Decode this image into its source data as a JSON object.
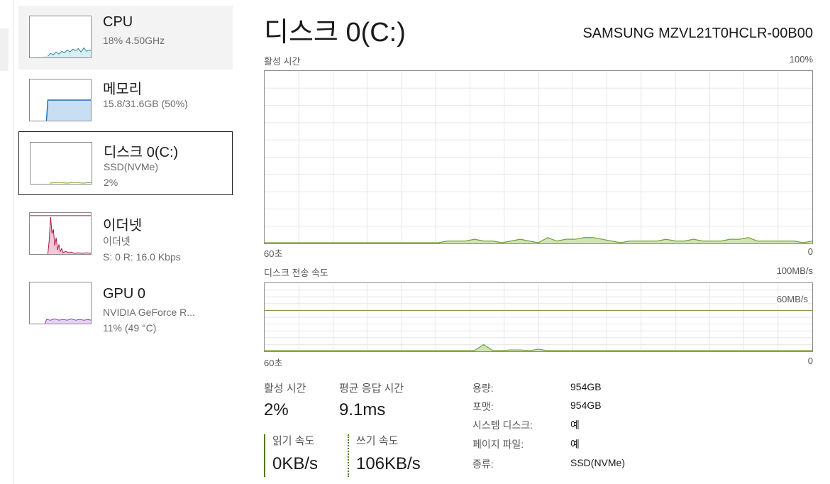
{
  "sidebar": {
    "items": [
      {
        "title": "CPU",
        "lines": [
          "18% 4.50GHz"
        ],
        "color": "#1a8aa8",
        "selected": false
      },
      {
        "title": "메모리",
        "lines": [
          "15.8/31.6GB (50%)"
        ],
        "color": "#1e6fc0",
        "selected": false
      },
      {
        "title": "디스크 0(C:)",
        "lines": [
          "SSD(NVMe)",
          "2%"
        ],
        "color": "#4c8a1e",
        "selected": true
      },
      {
        "title": "이더넷",
        "lines": [
          "이더넷",
          "S: 0 R: 16.0 Kbps"
        ],
        "color": "#b0124a",
        "selected": false
      },
      {
        "title": "GPU 0",
        "lines": [
          "NVIDIA GeForce R...",
          "11% (49 °C)"
        ],
        "color": "#8a2bbf",
        "selected": false
      }
    ]
  },
  "main": {
    "title": "디스크 0(C:)",
    "model": "SAMSUNG MZVL21T0HCLR-00B00",
    "active_chart": {
      "label": "활성 시간",
      "max_label": "100%",
      "x_left": "60초",
      "x_right": "0",
      "values": [
        0,
        0,
        0,
        0,
        0,
        0,
        0,
        0,
        0,
        0,
        0,
        0,
        0,
        0,
        0,
        0,
        0,
        0,
        0,
        0,
        1,
        1,
        1,
        2,
        1,
        1,
        0,
        1,
        2,
        1,
        0,
        3,
        1,
        2,
        2,
        3,
        3,
        2,
        1,
        0,
        1,
        1,
        1,
        1,
        2,
        1,
        1,
        2,
        1,
        1,
        1,
        2,
        2,
        3,
        1,
        1,
        1,
        1,
        1,
        0,
        1
      ]
    },
    "transfer_chart": {
      "label": "디스크 전송 속도",
      "max_label": "100MB/s",
      "ref_label": "60MB/s",
      "ref_value": 60,
      "x_left": "60초",
      "x_right": "0",
      "values": [
        0,
        0,
        0,
        0,
        0,
        0,
        0,
        0,
        0,
        0,
        0,
        0,
        0,
        0,
        0,
        0,
        0,
        0,
        0,
        0,
        0,
        0,
        0,
        0,
        9,
        0,
        0,
        1,
        1,
        0,
        2,
        0,
        0,
        0,
        0,
        0,
        0,
        0,
        0,
        0,
        0,
        0,
        0,
        0,
        0,
        0,
        0,
        0,
        0,
        0,
        0,
        0,
        0,
        0,
        0,
        0,
        0,
        0,
        0,
        0,
        0
      ]
    },
    "stats": {
      "active_label": "활성 시간",
      "active_value": "2%",
      "response_label": "평균 응답 시간",
      "response_value": "9.1ms",
      "read_label": "읽기 속도",
      "read_value": "0KB/s",
      "write_label": "쓰기 속도",
      "write_value": "106KB/s"
    },
    "info": [
      {
        "label": "용량:",
        "value": "954GB"
      },
      {
        "label": "포맷:",
        "value": "954GB"
      },
      {
        "label": "시스템 디스크:",
        "value": "예"
      },
      {
        "label": "페이지 파일:",
        "value": "예"
      },
      {
        "label": "종류:",
        "value": "SSD(NVMe)"
      }
    ]
  },
  "colors": {
    "disk_line": "#6ea33a",
    "disk_fill": "#cfe6b4",
    "grid": "#e6e6e6",
    "chart_border": "#8c8c8c"
  }
}
